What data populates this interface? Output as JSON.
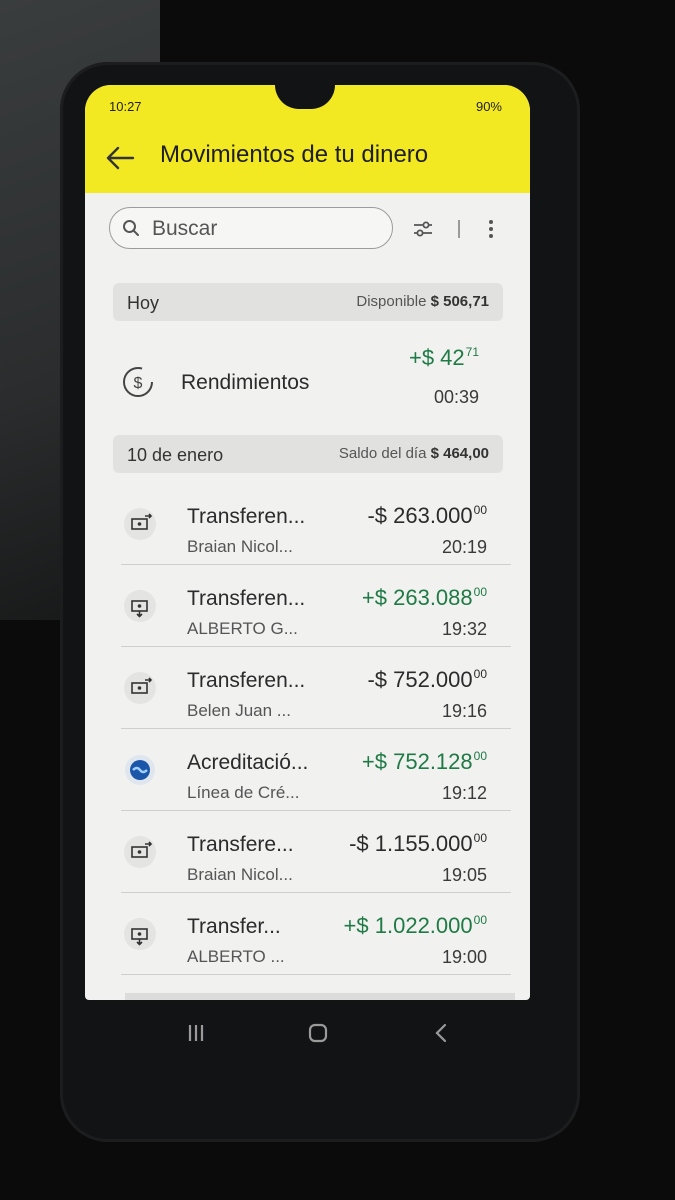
{
  "status_bar": {
    "time": "10:27",
    "right": "90%"
  },
  "header": {
    "title": "Movimientos de tu dinero"
  },
  "search": {
    "placeholder": "Buscar"
  },
  "today": {
    "label": "Hoy",
    "balance_label": "Disponible",
    "balance_value": "$ 506,71",
    "items": [
      {
        "title": "Rendimientos",
        "sign": "+",
        "amount": "$ 42",
        "cents": "71",
        "time": "00:39",
        "icon": "yield-icon"
      }
    ]
  },
  "day2": {
    "label": "10 de enero",
    "balance_label": "Saldo del día",
    "balance_value": "$ 464,00",
    "items": [
      {
        "title": "Transferen...",
        "subtitle": "Braian Nicol...",
        "sign": "-",
        "amount": "$ 263.000",
        "cents": "00",
        "time": "20:19",
        "positive": false
      },
      {
        "title": "Transferen...",
        "subtitle": "ALBERTO G...",
        "sign": "+",
        "amount": "$ 263.088",
        "cents": "00",
        "time": "19:32",
        "positive": true
      },
      {
        "title": "Transferen...",
        "subtitle": "Belen Juan ...",
        "sign": "-",
        "amount": "$ 752.000",
        "cents": "00",
        "time": "19:16",
        "positive": false
      },
      {
        "title": "Acreditació...",
        "subtitle": "Línea de Cré...",
        "sign": "+",
        "amount": "$ 752.128",
        "cents": "00",
        "time": "19:12",
        "positive": true
      },
      {
        "title": "Transfere...",
        "subtitle": "Braian Nicol...",
        "sign": "-",
        "amount": "$ 1.155.000",
        "cents": "00",
        "time": "19:05",
        "positive": false
      },
      {
        "title": "Transfer...",
        "subtitle": "ALBERTO ...",
        "sign": "+",
        "amount": "$ 1.022.000",
        "cents": "00",
        "time": "19:00",
        "positive": true
      }
    ]
  },
  "colors": {
    "header_yellow": "#f3e923",
    "positive_green": "#1f7a45",
    "negative_text": "#2b2b2b"
  }
}
